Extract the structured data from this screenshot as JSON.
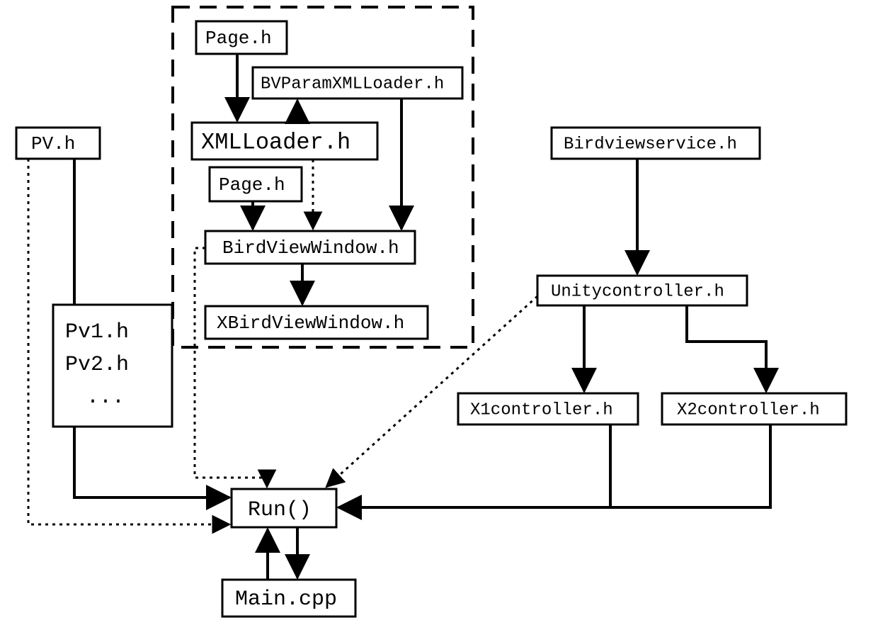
{
  "nodes": {
    "pv_h": "PV.h",
    "pv_list": [
      "Pv1.h",
      "Pv2.h",
      "..."
    ],
    "page_h_1": "Page.h",
    "bvparam": "BVParamXMLLoader.h",
    "xmlloader": "XMLLoader.h",
    "page_h_2": "Page.h",
    "bvwindow": "BirdViewWindow.h",
    "xbvwindow": "XBirdViewWindow.h",
    "bvservice": "Birdviewservice.h",
    "unityctrl": "Unitycontroller.h",
    "x1ctrl": "X1controller.h",
    "x2ctrl": "X2controller.h",
    "run": "Run()",
    "main": "Main.cpp"
  },
  "edges": [
    {
      "from": "pv_h",
      "to": "pv_list",
      "style": "solid"
    },
    {
      "from": "pv_h",
      "to": "run",
      "style": "dotted"
    },
    {
      "from": "pv_list",
      "to": "run",
      "style": "solid",
      "arrow": true
    },
    {
      "from": "page_h_1",
      "to": "xmlloader",
      "style": "solid",
      "arrow": true
    },
    {
      "from": "xmlloader",
      "to": "bvparam",
      "style": "solid",
      "arrow": true
    },
    {
      "from": "bvparam",
      "to": "bvwindow",
      "style": "solid",
      "arrow": true
    },
    {
      "from": "xmlloader",
      "to": "bvwindow",
      "style": "dotted",
      "arrow": true
    },
    {
      "from": "page_h_2",
      "to": "bvwindow",
      "style": "solid",
      "arrow": true
    },
    {
      "from": "bvwindow",
      "to": "xbvwindow",
      "style": "solid",
      "arrow": true
    },
    {
      "from": "bvwindow",
      "to": "run",
      "style": "dotted",
      "arrow": true
    },
    {
      "from": "bvservice",
      "to": "unityctrl",
      "style": "solid",
      "arrow": true
    },
    {
      "from": "unityctrl",
      "to": "x1ctrl",
      "style": "solid",
      "arrow": true
    },
    {
      "from": "unityctrl",
      "to": "x2ctrl",
      "style": "solid",
      "arrow": true
    },
    {
      "from": "unityctrl",
      "to": "run",
      "style": "dotted",
      "arrow": true
    },
    {
      "from": "x1ctrl",
      "to": "run",
      "style": "solid",
      "arrow": true
    },
    {
      "from": "x2ctrl",
      "to": "run",
      "style": "solid",
      "arrow": true
    },
    {
      "from": "run",
      "to": "main",
      "style": "solid",
      "arrow": true
    },
    {
      "from": "main",
      "to": "run",
      "style": "solid",
      "arrow": true
    }
  ],
  "groups": [
    {
      "contains": [
        "page_h_1",
        "bvparam",
        "xmlloader",
        "page_h_2",
        "bvwindow",
        "xbvwindow"
      ],
      "style": "dashed"
    }
  ]
}
